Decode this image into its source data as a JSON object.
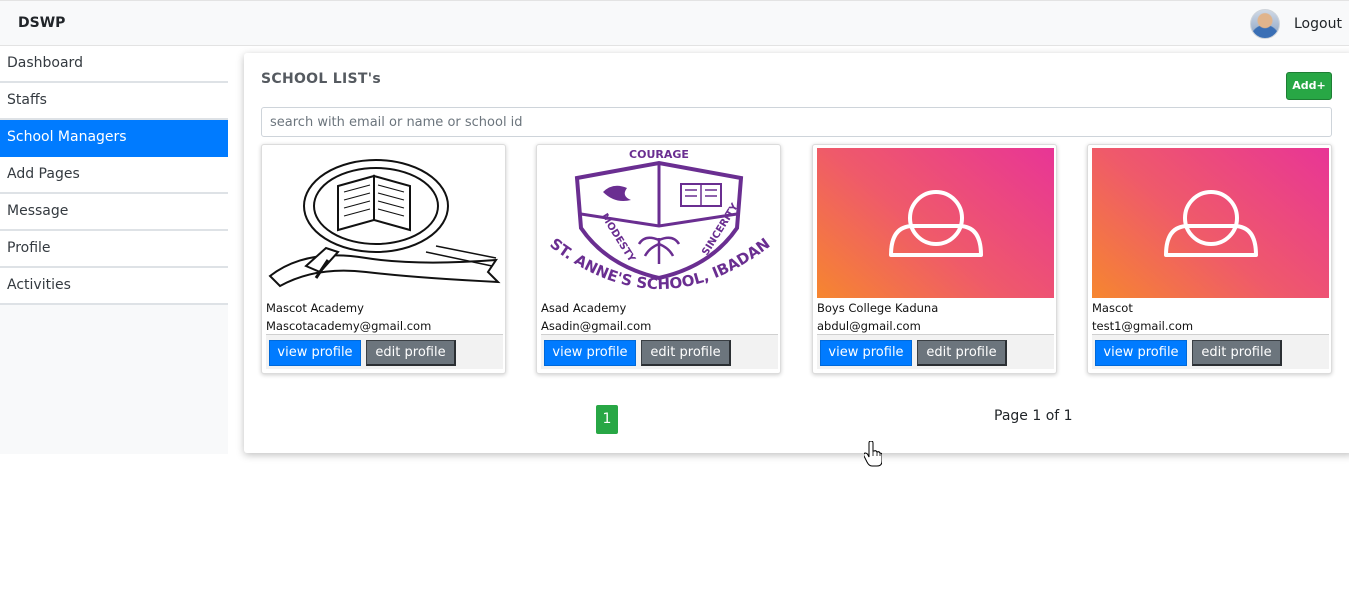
{
  "navbar": {
    "brand": "DSWP",
    "logout": "Logout"
  },
  "sidebar": {
    "items": [
      {
        "label": "Dashboard",
        "active": false
      },
      {
        "label": "Staffs",
        "active": false
      },
      {
        "label": "School Managers",
        "active": true
      },
      {
        "label": "Add Pages",
        "active": false
      },
      {
        "label": "Message",
        "active": false
      },
      {
        "label": "Profile",
        "active": false
      },
      {
        "label": "Activities",
        "active": false
      }
    ]
  },
  "main": {
    "title": "SCHOOL LIST's",
    "add_label": "Add+",
    "search_placeholder": "search with email or name or school id",
    "schools": [
      {
        "name": "Mascot Academy",
        "email": "Mascotacademy@gmail.com",
        "image": "book-emblem-logo",
        "view_label": "view profile",
        "edit_label": "edit profile"
      },
      {
        "name": "Asad Academy",
        "email": "Asadin@gmail.com",
        "image": "st-annes-school-crest",
        "view_label": "view profile",
        "edit_label": "edit profile"
      },
      {
        "name": "Boys College Kaduna",
        "email": "abdul@gmail.com",
        "image": "default-user-placeholder",
        "view_label": "view profile",
        "edit_label": "edit profile"
      },
      {
        "name": "Mascot",
        "email": "test1@gmail.com",
        "image": "default-user-placeholder",
        "view_label": "view profile",
        "edit_label": "edit profile"
      }
    ],
    "crest_text": {
      "top": "COURAGE",
      "left": "MODESTY",
      "right": "SINCERITY",
      "bottom": "ST. ANNE'S SCHOOL, IBADAN"
    },
    "pagination": {
      "current_page": "1",
      "info": "Page 1 of 1"
    }
  },
  "colors": {
    "primary": "#007bff",
    "success": "#28a745",
    "secondary": "#6c757d",
    "crest_purple": "#6a2e91"
  }
}
